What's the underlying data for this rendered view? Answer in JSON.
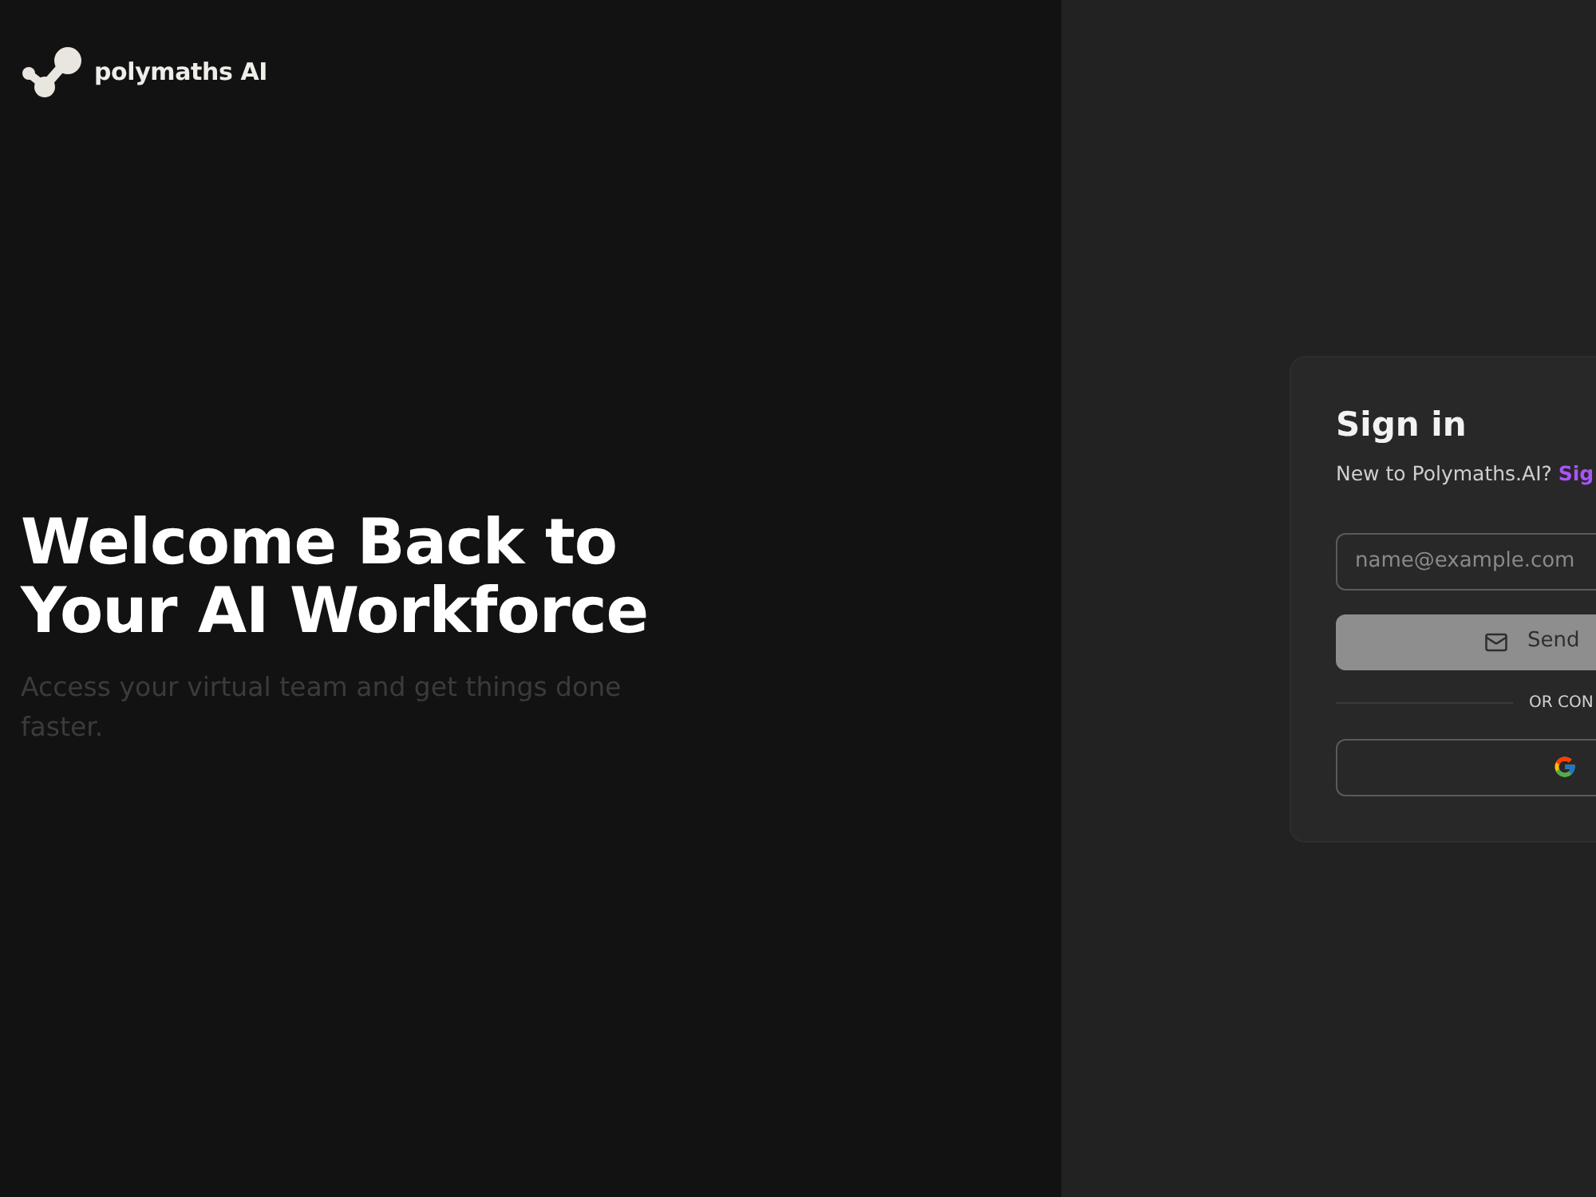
{
  "brand": {
    "name": "polymaths AI"
  },
  "hero": {
    "title_lines": [
      "Welcome Back to",
      "Your AI Workforce"
    ],
    "subtitle": "Access your virtual team and get things done faster."
  },
  "signin": {
    "title": "Sign in",
    "prompt": "New to Polymaths.AI?",
    "signup_link": "Sig",
    "email_field": {
      "placeholder": "name@example.com"
    },
    "send_button": {
      "label": "Send",
      "disabled": true
    },
    "divider_text": "OR CON"
  }
}
